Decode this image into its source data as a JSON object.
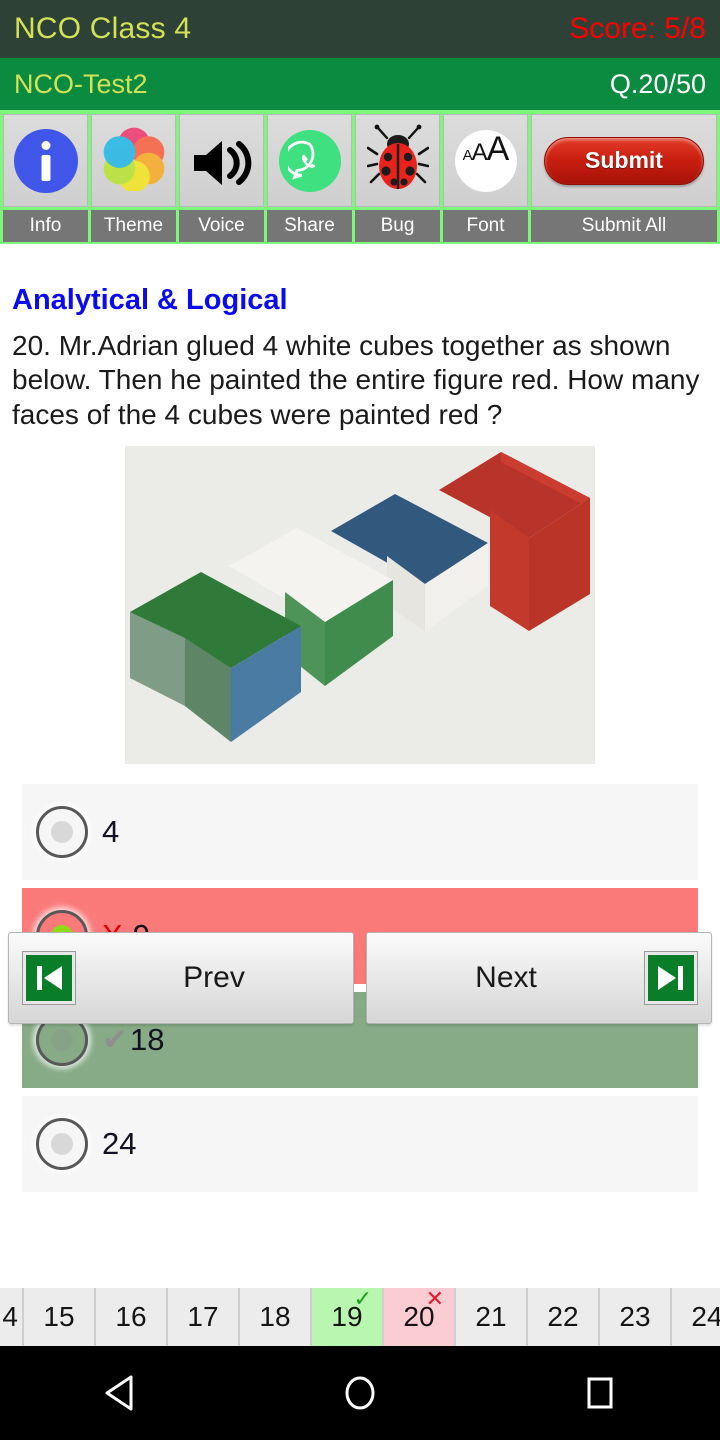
{
  "statusbar": {
    "app_title": "NCO Class 4",
    "score": "Score: 5/8",
    "score_color": "#ff0000",
    "title_color": "#d4e157",
    "bg": "#2d4136"
  },
  "testbar": {
    "test_name": "NCO-Test2",
    "question_counter": "Q.20/50",
    "bg": "#0a8b3f"
  },
  "toolbar": {
    "bg": "#7cf77c",
    "items": [
      {
        "icon": "info-icon",
        "label": "Info"
      },
      {
        "icon": "palette-icon",
        "label": "Theme"
      },
      {
        "icon": "speaker-icon",
        "label": "Voice"
      },
      {
        "icon": "whatsapp-icon",
        "label": "Share"
      },
      {
        "icon": "ladybug-icon",
        "label": "Bug"
      },
      {
        "icon": "font-size-icon",
        "label": "Font"
      }
    ],
    "submit_button_label": "Submit",
    "submit_label": "Submit All",
    "submit_color": "#c81e10"
  },
  "question": {
    "topic": "Analytical & Logical",
    "topic_color": "#0b0bef",
    "text": "20. Mr.Adrian glued 4 white cubes together as shown below. Then he painted the entire figure red. How many faces of the 4 cubes were painted red ?",
    "figure_alt": "four glued cubes photo: green, white, blue, red top faces"
  },
  "options": [
    {
      "text": "4",
      "state": "neutral",
      "selected": false,
      "mark": ""
    },
    {
      "text": "9",
      "state": "wrong",
      "selected": true,
      "mark": "X"
    },
    {
      "text": "18",
      "state": "correct",
      "selected": false,
      "mark": "✔"
    },
    {
      "text": "24",
      "state": "neutral",
      "selected": false,
      "mark": ""
    }
  ],
  "navigation": {
    "prev_label": "Prev",
    "next_label": "Next"
  },
  "question_strip": {
    "cells": [
      {
        "num": "4",
        "state": "partial-left"
      },
      {
        "num": "15",
        "state": "none"
      },
      {
        "num": "16",
        "state": "none"
      },
      {
        "num": "17",
        "state": "none"
      },
      {
        "num": "18",
        "state": "none"
      },
      {
        "num": "19",
        "state": "ok",
        "mark": "✓"
      },
      {
        "num": "20",
        "state": "bad",
        "mark": "✕"
      },
      {
        "num": "21",
        "state": "none"
      },
      {
        "num": "22",
        "state": "none"
      },
      {
        "num": "23",
        "state": "none"
      },
      {
        "num": "24",
        "state": "none"
      }
    ]
  },
  "android_nav": {
    "back": "back-triangle-icon",
    "home": "home-circle-icon",
    "recents": "recents-square-icon"
  }
}
